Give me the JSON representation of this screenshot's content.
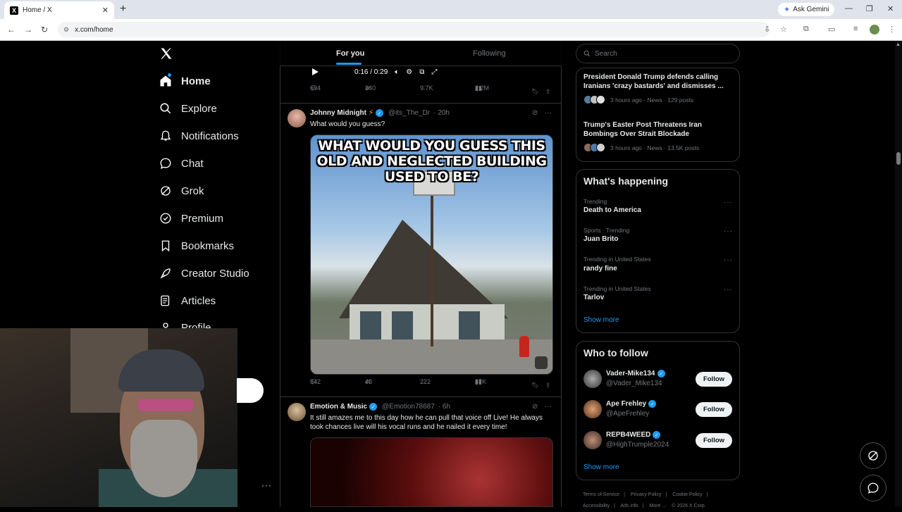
{
  "browser": {
    "tab_title": "Home / X",
    "tab_favicon": "X",
    "url": "x.com/home",
    "ask_gemini": "Ask Gemini"
  },
  "sidebar": {
    "items": [
      {
        "label": "Home",
        "icon": "home-icon"
      },
      {
        "label": "Explore",
        "icon": "search-icon"
      },
      {
        "label": "Notifications",
        "icon": "bell-icon"
      },
      {
        "label": "Chat",
        "icon": "chat-icon"
      },
      {
        "label": "Grok",
        "icon": "grok-icon"
      },
      {
        "label": "Premium",
        "icon": "premium-icon"
      },
      {
        "label": "Bookmarks",
        "icon": "bookmark-icon"
      },
      {
        "label": "Creator Studio",
        "icon": "rocket-icon"
      },
      {
        "label": "Articles",
        "icon": "article-icon"
      },
      {
        "label": "Profile",
        "icon": "profile-icon"
      }
    ]
  },
  "feed_tabs": {
    "for_you": "For you",
    "following": "Following"
  },
  "video": {
    "time": "0:16 / 0:29"
  },
  "post0": {
    "replies": "694",
    "reposts": "340",
    "likes": "9.7K",
    "views": "2.2M"
  },
  "post1": {
    "name": "Johnny Midnight",
    "emoji": "⚡",
    "handle": "@its_The_Dr",
    "time": "· 20h",
    "text": "What would you guess?",
    "meme_caption": "WHAT WOULD YOU GUESS THIS OLD AND NEGLECTED BUILDING USED TO BE?",
    "replies": "842",
    "reposts": "43",
    "likes": "222",
    "views": "87K"
  },
  "post2": {
    "name": "Emotion & Music",
    "handle": "@Emotion78687",
    "time": "· 6h",
    "text": "It still amazes me to this day how he can pull that voice off Live! He always took chances live will his vocal runs and he nailed it every time!"
  },
  "search": {
    "placeholder": "Search"
  },
  "news": [
    {
      "title": "President Donald Trump defends calling Iranians 'crazy bastards' and dismisses ...",
      "meta": "3 hours ago · News · 129 posts"
    },
    {
      "title": "Trump's Easter Post Threatens Iran Bombings Over Strait Blockade",
      "meta": "3 hours ago · News · 13.5K posts"
    }
  ],
  "whats_happening": {
    "title": "What's happening",
    "trends": [
      {
        "category": "Trending",
        "name": "Death to America"
      },
      {
        "category": "Sports · Trending",
        "name": "Juan Brito"
      },
      {
        "category": "Trending in United States",
        "name": "randy fine"
      },
      {
        "category": "Trending in United States",
        "name": "Tarlov"
      }
    ],
    "show_more": "Show more"
  },
  "who_to_follow": {
    "title": "Who to follow",
    "users": [
      {
        "name": "Vader-Mike134",
        "handle": "@Vader_Mike134",
        "button": "Follow"
      },
      {
        "name": "Ape Frehley",
        "handle": "@ApeFrehley",
        "button": "Follow"
      },
      {
        "name": "REPB4WEED",
        "handle": "@HighTrumple2024",
        "button": "Follow"
      }
    ],
    "show_more": "Show more"
  },
  "footer": {
    "links": [
      "Terms of Service",
      "|",
      "Privacy Policy",
      "|",
      "Cookie Policy",
      "|",
      "Accessibility",
      "|",
      "Ads info",
      "|",
      "More ...",
      "© 2026 X Corp."
    ]
  }
}
